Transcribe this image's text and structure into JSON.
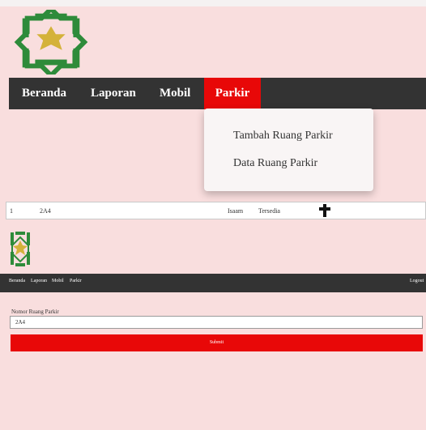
{
  "top_app": {
    "nav": {
      "items": [
        "Beranda",
        "Laporan",
        "Mobil",
        "Parkir"
      ],
      "active": "Parkir"
    },
    "dropdown": {
      "items": [
        "Tambah Ruang Parkir",
        "Data Ruang Parkir"
      ]
    },
    "table_row": {
      "no": "1",
      "nomor": "2A4",
      "col3": "Isaam",
      "status": "Tersedia"
    }
  },
  "bottom_app": {
    "nav": {
      "items": [
        "Beranda",
        "Laporan",
        "Mobil",
        "Parkir"
      ],
      "logout": "Logout"
    },
    "form": {
      "label": "Nomor Ruang Parkir",
      "value": "2A4",
      "submit": "Submit"
    }
  },
  "colors": {
    "background": "#f9dede",
    "nav": "#333333",
    "accent": "#e80808",
    "logo_green": "#2e8b3a",
    "logo_gold": "#d4b23a"
  },
  "icons": [
    "logo-emblem-icon",
    "plus-icon"
  ]
}
